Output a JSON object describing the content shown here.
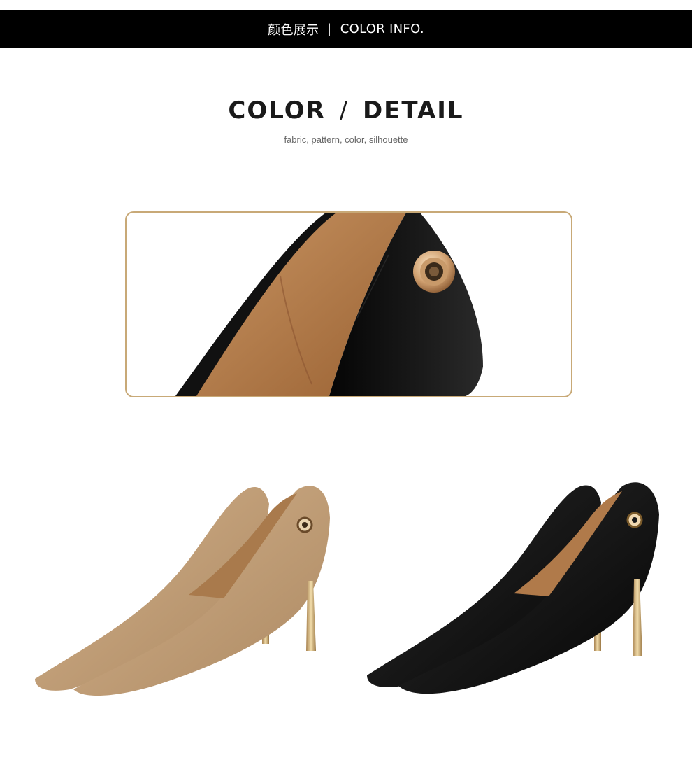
{
  "header": {
    "title_cn": "颜色展示",
    "separator": "|",
    "title_en": "COLOR INFO."
  },
  "section": {
    "heading_left": "COLOR",
    "heading_slash": "/",
    "heading_right": "DETAIL",
    "subheading": "fabric, pattern, color, silhouette"
  },
  "colors": {
    "accent_border": "#c8a977",
    "khaki_leather": "#c4a27c",
    "black_leather": "#121212",
    "lining": "#b07a4a",
    "heel_metal": "#c9a868"
  },
  "images": {
    "detail": "heel-eyelet-closeup-image",
    "shoe_khaki": "khaki-pump-image",
    "shoe_black": "black-pump-image"
  }
}
